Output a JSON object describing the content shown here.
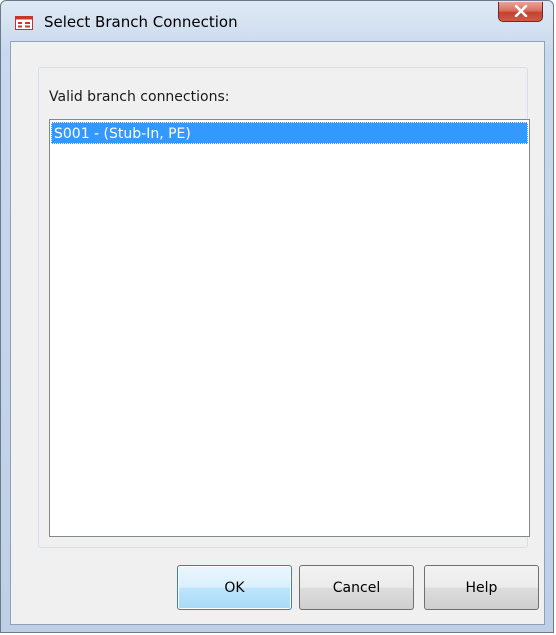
{
  "window": {
    "title": "Select Branch Connection",
    "close_icon": "close-icon",
    "app_icon": "dialog-icon"
  },
  "content": {
    "list_label": "Valid branch connections:",
    "items": [
      {
        "label": "S001 - (Stub-In, PE)",
        "selected": true
      }
    ]
  },
  "buttons": {
    "ok_label": "OK",
    "cancel_label": "Cancel",
    "help_label": "Help"
  },
  "colors": {
    "selection": "#3399ff",
    "close_button": "#c94a36",
    "default_button_border": "#3c7fb1"
  }
}
